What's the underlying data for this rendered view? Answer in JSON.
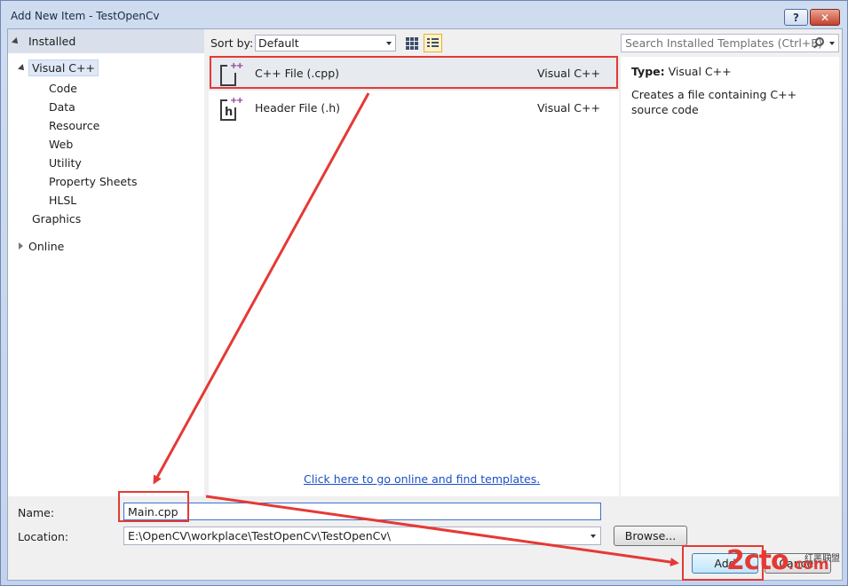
{
  "window": {
    "title": "Add New Item - TestOpenCv",
    "help_label": "?",
    "close_label": "✕"
  },
  "left_pane": {
    "installed": "Installed",
    "tree": {
      "root": "Visual C++",
      "children": [
        "Code",
        "Data",
        "Resource",
        "Web",
        "Utility",
        "Property Sheets",
        "HLSL",
        "Graphics"
      ],
      "online": "Online"
    }
  },
  "toolbar": {
    "sort_by_label": "Sort by:",
    "sort_by_value": "Default",
    "search_placeholder": "Search Installed Templates (Ctrl+E)"
  },
  "templates": [
    {
      "name": "C++ File (.cpp)",
      "language": "Visual C++",
      "icon": "cpp-file-icon",
      "selected": true
    },
    {
      "name": "Header File (.h)",
      "language": "Visual C++",
      "icon": "header-file-icon",
      "selected": false
    }
  ],
  "online_link": "Click here to go online and find templates.",
  "details": {
    "type_key": "Type:",
    "type_value": "Visual C++",
    "description": "Creates a file containing C++ source code"
  },
  "bottom": {
    "name_label": "Name:",
    "name_value": "Main.cpp",
    "location_label": "Location:",
    "location_value": "E:\\OpenCV\\workplace\\TestOpenCv\\TestOpenCv\\",
    "browse_label": "Browse...",
    "add_label": "Add",
    "cancel_label": "Cancel"
  },
  "watermark": {
    "logo": "2cto",
    "logo_suffix": ".com",
    "caption": "红黑联盟"
  },
  "colors": {
    "annotation": "#e53935",
    "link": "#1d4fc7",
    "selection": "#e7eaee"
  }
}
